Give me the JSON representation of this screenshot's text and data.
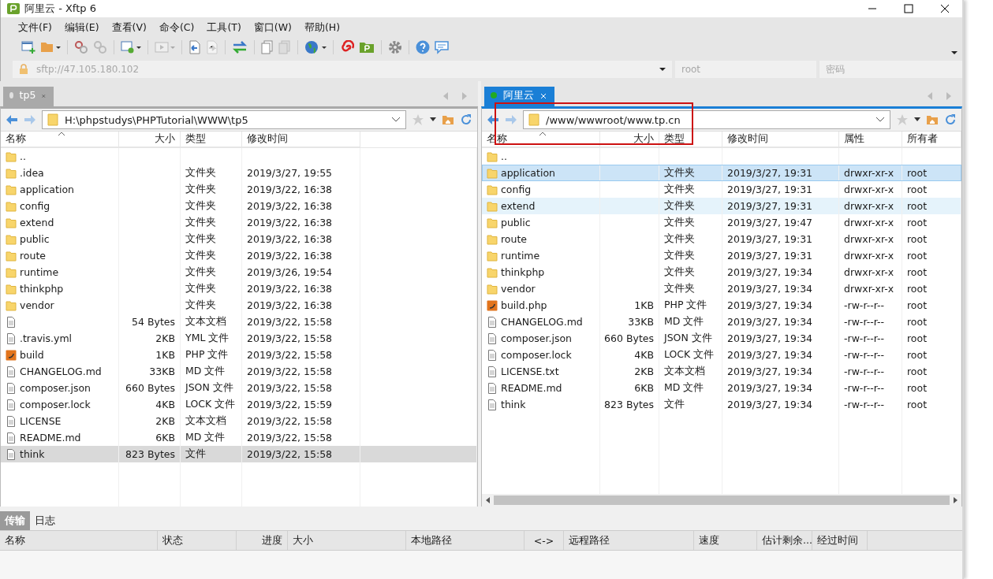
{
  "window": {
    "title": "阿里云 - Xftp 6"
  },
  "menu": [
    "文件(F)",
    "编辑(E)",
    "查看(V)",
    "命令(C)",
    "工具(T)",
    "窗口(W)",
    "帮助(H)"
  ],
  "connection": {
    "address_placeholder": "sftp://47.105.180.102",
    "user_placeholder": "root",
    "password_placeholder": "密码"
  },
  "left_pane": {
    "tab": {
      "label": "tp5",
      "selected": false,
      "connected": false
    },
    "path": "H:\\phpstudys\\PHPTutorial\\WWW\\tp5",
    "columns": [
      "名称",
      "大小",
      "类型",
      "修改时间"
    ],
    "rows": [
      {
        "name": "..",
        "kind": "folder",
        "selected": false
      },
      {
        "name": ".idea",
        "type": "文件夹",
        "modified": "2019/3/27, 19:55",
        "kind": "folder",
        "selected": false
      },
      {
        "name": "application",
        "type": "文件夹",
        "modified": "2019/3/22, 16:38",
        "kind": "folder",
        "selected": false
      },
      {
        "name": "config",
        "type": "文件夹",
        "modified": "2019/3/22, 16:38",
        "kind": "folder",
        "selected": false
      },
      {
        "name": "extend",
        "type": "文件夹",
        "modified": "2019/3/22, 16:38",
        "kind": "folder",
        "selected": false
      },
      {
        "name": "public",
        "type": "文件夹",
        "modified": "2019/3/22, 16:38",
        "kind": "folder",
        "selected": false
      },
      {
        "name": "route",
        "type": "文件夹",
        "modified": "2019/3/22, 16:38",
        "kind": "folder",
        "selected": false
      },
      {
        "name": "runtime",
        "type": "文件夹",
        "modified": "2019/3/26, 19:54",
        "kind": "folder",
        "selected": false
      },
      {
        "name": "thinkphp",
        "type": "文件夹",
        "modified": "2019/3/22, 16:38",
        "kind": "folder",
        "selected": false
      },
      {
        "name": "vendor",
        "type": "文件夹",
        "modified": "2019/3/22, 16:38",
        "kind": "folder",
        "selected": false
      },
      {
        "size": "54 Bytes",
        "type": "文本文档",
        "modified": "2019/3/22, 15:58",
        "kind": "file",
        "selected": false
      },
      {
        "name": ".travis.yml",
        "size": "2KB",
        "type": "YML 文件",
        "modified": "2019/3/22, 15:58",
        "kind": "file",
        "selected": false
      },
      {
        "name": "build",
        "size": "1KB",
        "type": "PHP 文件",
        "modified": "2019/3/22, 15:58",
        "kind": "php",
        "selected": false
      },
      {
        "name": "CHANGELOG.md",
        "size": "33KB",
        "type": "MD 文件",
        "modified": "2019/3/22, 15:58",
        "kind": "file",
        "selected": false
      },
      {
        "name": "composer.json",
        "size": "660 Bytes",
        "type": "JSON 文件",
        "modified": "2019/3/22, 15:58",
        "kind": "file",
        "selected": false
      },
      {
        "name": "composer.lock",
        "size": "4KB",
        "type": "LOCK 文件",
        "modified": "2019/3/22, 15:59",
        "kind": "file",
        "selected": false
      },
      {
        "name": "LICENSE",
        "size": "2KB",
        "type": "文本文档",
        "modified": "2019/3/22, 15:58",
        "kind": "file",
        "selected": false
      },
      {
        "name": "README.md",
        "size": "6KB",
        "type": "MD 文件",
        "modified": "2019/3/22, 15:58",
        "kind": "file",
        "selected": false
      },
      {
        "name": "think",
        "size": "823 Bytes",
        "type": "文件",
        "modified": "2019/3/22, 15:58",
        "kind": "file",
        "selected": true
      }
    ]
  },
  "right_pane": {
    "tab": {
      "label": "阿里云",
      "selected": true,
      "connected": true
    },
    "path": "/www/wwwroot/www.tp.cn",
    "columns": [
      "名称",
      "大小",
      "类型",
      "修改时间",
      "属性",
      "所有者"
    ],
    "rows": [
      {
        "name": "..",
        "kind": "folder",
        "selected": false,
        "hovered": false
      },
      {
        "name": "application",
        "type": "文件夹",
        "modified": "2019/3/27, 19:31",
        "permissions": "drwxr-xr-x",
        "owner": "root",
        "kind": "folder",
        "selected": true,
        "hovered": false
      },
      {
        "name": "config",
        "type": "文件夹",
        "modified": "2019/3/27, 19:31",
        "permissions": "drwxr-xr-x",
        "owner": "root",
        "kind": "folder",
        "selected": false,
        "hovered": false
      },
      {
        "name": "extend",
        "type": "文件夹",
        "modified": "2019/3/27, 19:31",
        "permissions": "drwxr-xr-x",
        "owner": "root",
        "kind": "folder",
        "selected": false,
        "hovered": true
      },
      {
        "name": "public",
        "type": "文件夹",
        "modified": "2019/3/27, 19:47",
        "permissions": "drwxr-xr-x",
        "owner": "root",
        "kind": "folder",
        "selected": false,
        "hovered": false
      },
      {
        "name": "route",
        "type": "文件夹",
        "modified": "2019/3/27, 19:31",
        "permissions": "drwxr-xr-x",
        "owner": "root",
        "kind": "folder",
        "selected": false,
        "hovered": false
      },
      {
        "name": "runtime",
        "type": "文件夹",
        "modified": "2019/3/27, 19:31",
        "permissions": "drwxr-xr-x",
        "owner": "root",
        "kind": "folder",
        "selected": false,
        "hovered": false
      },
      {
        "name": "thinkphp",
        "type": "文件夹",
        "modified": "2019/3/27, 19:34",
        "permissions": "drwxr-xr-x",
        "owner": "root",
        "kind": "folder",
        "selected": false,
        "hovered": false
      },
      {
        "name": "vendor",
        "type": "文件夹",
        "modified": "2019/3/27, 19:34",
        "permissions": "drwxr-xr-x",
        "owner": "root",
        "kind": "folder",
        "selected": false,
        "hovered": false
      },
      {
        "name": "build.php",
        "size": "1KB",
        "type": "PHP 文件",
        "modified": "2019/3/27, 19:34",
        "permissions": "-rw-r--r--",
        "owner": "root",
        "kind": "php",
        "selected": false,
        "hovered": false
      },
      {
        "name": "CHANGELOG.md",
        "size": "33KB",
        "type": "MD 文件",
        "modified": "2019/3/27, 19:34",
        "permissions": "-rw-r--r--",
        "owner": "root",
        "kind": "file",
        "selected": false,
        "hovered": false
      },
      {
        "name": "composer.json",
        "size": "660 Bytes",
        "type": "JSON 文件",
        "modified": "2019/3/27, 19:34",
        "permissions": "-rw-r--r--",
        "owner": "root",
        "kind": "file",
        "selected": false,
        "hovered": false
      },
      {
        "name": "composer.lock",
        "size": "4KB",
        "type": "LOCK 文件",
        "modified": "2019/3/27, 19:34",
        "permissions": "-rw-r--r--",
        "owner": "root",
        "kind": "file",
        "selected": false,
        "hovered": false
      },
      {
        "name": "LICENSE.txt",
        "size": "2KB",
        "type": "文本文档",
        "modified": "2019/3/27, 19:34",
        "permissions": "-rw-r--r--",
        "owner": "root",
        "kind": "file",
        "selected": false,
        "hovered": false
      },
      {
        "name": "README.md",
        "size": "6KB",
        "type": "MD 文件",
        "modified": "2019/3/27, 19:34",
        "permissions": "-rw-r--r--",
        "owner": "root",
        "kind": "file",
        "selected": false,
        "hovered": false
      },
      {
        "name": "think",
        "size": "823 Bytes",
        "type": "文件",
        "modified": "2019/3/27, 19:34",
        "permissions": "-rw-r--r--",
        "owner": "root",
        "kind": "file",
        "selected": false,
        "hovered": false
      }
    ]
  },
  "transfer_panel": {
    "tabs": [
      {
        "label": "传输",
        "selected": true
      },
      {
        "label": "日志",
        "selected": false
      }
    ],
    "columns": [
      "名称",
      "状态",
      "进度",
      "大小",
      "本地路径",
      "<->",
      "远程路径",
      "速度",
      "估计剩余...",
      "经过时间"
    ]
  }
}
